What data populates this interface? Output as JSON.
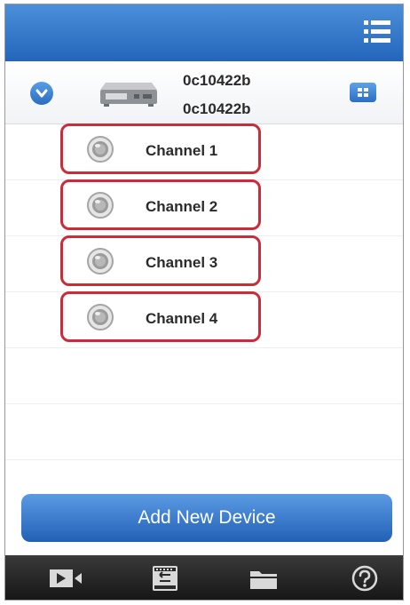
{
  "device": {
    "name": "0c10422b",
    "id": "0c10422b"
  },
  "channels": [
    {
      "label": "Channel 1"
    },
    {
      "label": "Channel 2"
    },
    {
      "label": "Channel 3"
    },
    {
      "label": "Channel 4"
    }
  ],
  "add_device_label": "Add New Device",
  "icons": {
    "menu": "list-menu-icon",
    "expand": "chevron-down-icon",
    "device": "dvr-recorder-icon",
    "grid": "grid-view-icon",
    "camera": "camera-lens-icon",
    "live": "video-camera-icon",
    "playback": "playback-icon",
    "files": "folder-icon",
    "help": "help-icon"
  },
  "colors": {
    "header_blue": "#2f72c6",
    "highlight_red": "#cc2b3a",
    "tabbar": "#1e1e1e"
  }
}
